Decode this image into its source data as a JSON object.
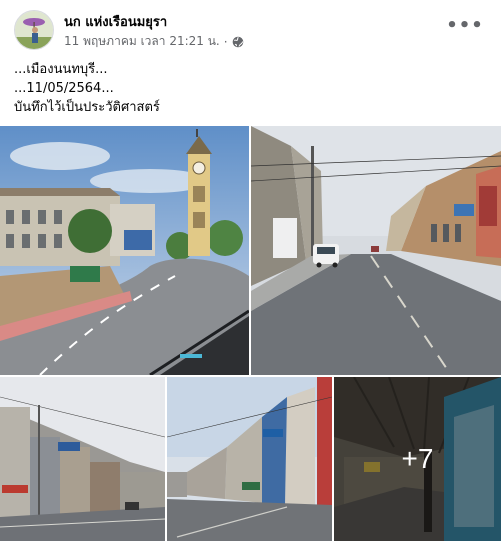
{
  "post": {
    "author": "นก แห่งเรือนมยุรา",
    "timestamp": "11 พฤษภาคม เวลา 21:21 น.",
    "separator": "·",
    "audience_icon": "globe-icon",
    "more_icon": "more-horizontal-icon",
    "more_label": "•••",
    "text_lines": [
      "...เมืองนนทบุรี...",
      "...11/05/2564...",
      "บันทึกไว้เป็นประวัติศาสตร์"
    ],
    "photos": [
      {
        "description_icon": "photo-clock-tower-street"
      },
      {
        "description_icon": "photo-empty-city-street"
      },
      {
        "description_icon": "photo-shophouse-street"
      },
      {
        "description_icon": "photo-wide-road-shops"
      },
      {
        "description_icon": "photo-covered-walkway"
      }
    ],
    "extra_photos_label": "+7"
  }
}
